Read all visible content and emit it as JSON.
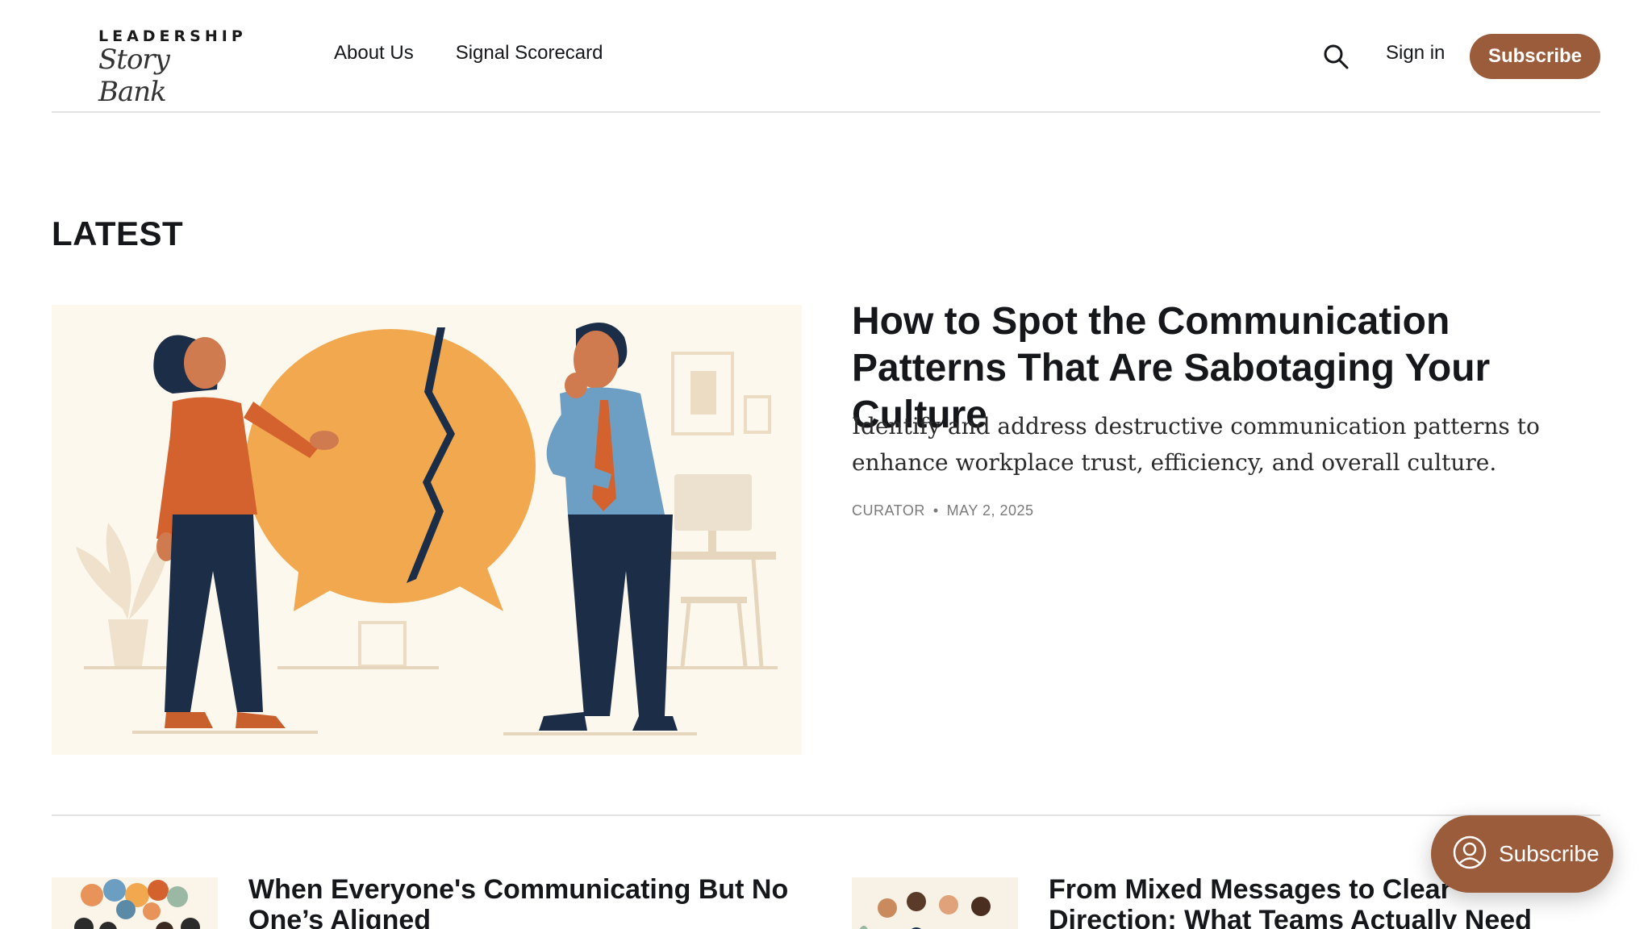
{
  "header": {
    "logo_top": "LEADERSHIP",
    "logo_script": "Story Bank",
    "nav": [
      {
        "label": "About Us"
      },
      {
        "label": "Signal Scorecard"
      }
    ],
    "search_icon": "search-icon",
    "signin_label": "Sign in",
    "subscribe_label": "Subscribe"
  },
  "section": {
    "title": "LATEST"
  },
  "featured": {
    "title": "How to Spot the Communication Patterns That Are Sabotaging Your Culture",
    "excerpt": "Identify and address destructive communication patterns to enhance workplace trust, efficiency, and overall culture.",
    "author": "CURATOR",
    "separator": "•",
    "date": "MAY 2, 2025"
  },
  "cards": [
    {
      "title": "When Everyone's Communicating But No One’s Aligned"
    },
    {
      "title": "From Mixed Messages to Clear Direction: What Teams Actually Need"
    }
  ],
  "portal": {
    "label": "Subscribe",
    "icon": "user-circle-icon"
  },
  "colors": {
    "accent": "#9b5c3c",
    "text": "#15171a",
    "muted": "#7a7a7a"
  }
}
